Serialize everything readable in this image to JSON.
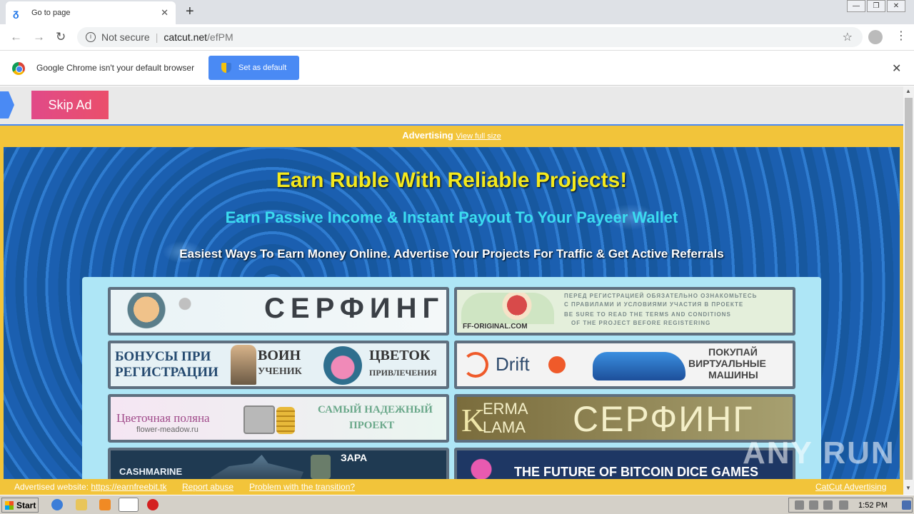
{
  "browser": {
    "tab_title": "Go to page",
    "url_security": "Not secure",
    "url_domain": "catcut.net",
    "url_path": "/efPM"
  },
  "infobar": {
    "message": "Google Chrome isn't your default browser",
    "button": "Set as default"
  },
  "page": {
    "skip_ad": "Skip Ad",
    "ad_label": "Advertising",
    "view_full": "View full size",
    "headline": "Earn Ruble With Reliable Projects!",
    "subheadline": "Earn Passive Income & Instant Payout To Your Payeer Wallet",
    "tagline": "Easiest Ways To Earn Money Online. Advertise Your Projects For Traffic & Get Active Referrals",
    "banners": [
      {
        "text": "СЕРФИНГ"
      },
      {
        "text": "ПЕРЕД РЕГИСТРАЦИЕЙ ОБЯЗАТЕЛЬНО ОЗНАКОМЬТЕСЬ",
        "text2": "С ПРАВИЛАМИ И УСЛОВИЯМИ УЧАСТИЯ В ПРОЕКТЕ",
        "text3": "BE SURE TO READ THE TERMS AND CONDITIONS",
        "text4": "OF THE PROJECT BEFORE REGISTERING",
        "text5": "FF-ORIGINAL.COM"
      },
      {
        "text": "БОНУСЫ ПРИ",
        "text2": "РЕГИСТРАЦИИ",
        "text3": "ВОИН",
        "text4": "УЧЕНИК",
        "text5": "ЦВЕТОК",
        "text6": "ПРИВЛЕЧЕНИЯ"
      },
      {
        "text": "Drift",
        "text2": "ПОКУПАЙ",
        "text3": "ВИРТУАЛЬНЫЕ",
        "text4": "МАШИНЫ"
      },
      {
        "text": "Цветочная поляна",
        "text2": "flower-meadow.ru",
        "text3": "САМЫЙ НАДЕЖНЫЙ",
        "text4": "ПРОЕКТ"
      },
      {
        "text": "ERMA",
        "text2": "LAMA",
        "text3": "СЕРФИНГ"
      },
      {
        "text": "CASHMARINE",
        "text2": "ЗАРА"
      },
      {
        "text": "THE FUTURE OF BITCOIN DICE GAMES"
      }
    ]
  },
  "footer": {
    "advertised_label": "Advertised website:",
    "advertised_url": "https://earnfreebit.tk",
    "report": "Report abuse",
    "problem": "Problem with the transition?",
    "catcut": "CatCut Advertising"
  },
  "watermark": "ANY RUN",
  "taskbar": {
    "start": "Start",
    "clock": "1:52 PM"
  }
}
